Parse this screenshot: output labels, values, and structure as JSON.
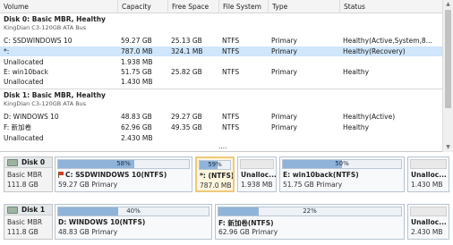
{
  "columns": [
    "Volume",
    "Capacity",
    "Free Space",
    "File System",
    "Type",
    "Status"
  ],
  "disk0": {
    "title": "Disk 0: Basic MBR, Healthy",
    "subtitle": "KingDian C3-120GB ATA Bus",
    "rows": [
      {
        "volume": "C: SSDWINDOWS 10",
        "capacity": "59.27 GB",
        "free": "25.13 GB",
        "fs": "NTFS",
        "type": "Primary",
        "status": "Healthy(Active,System,8..."
      },
      {
        "volume": "*:",
        "capacity": "787.0 MB",
        "free": "324.1 MB",
        "fs": "NTFS",
        "type": "Primary",
        "status": "Healthy(Recovery)"
      },
      {
        "volume": "Unallocated",
        "capacity": "1.938 MB",
        "free": "",
        "fs": "",
        "type": "",
        "status": ""
      },
      {
        "volume": "E: win10back",
        "capacity": "51.75 GB",
        "free": "25.82 GB",
        "fs": "NTFS",
        "type": "Primary",
        "status": "Healthy"
      },
      {
        "volume": "Unallocated",
        "capacity": "1.430 MB",
        "free": "",
        "fs": "",
        "type": "",
        "status": ""
      }
    ]
  },
  "disk1": {
    "title": "Disk 1: Basic MBR, Healthy",
    "subtitle": "KingDian C3-120GB ATA Bus",
    "rows": [
      {
        "volume": "D: WINDOWS 10",
        "capacity": "48.83 GB",
        "free": "29.27 GB",
        "fs": "NTFS",
        "type": "Primary",
        "status": "Healthy(Active)"
      },
      {
        "volume": "F: 新加卷",
        "capacity": "62.96 GB",
        "free": "49.35 GB",
        "fs": "NTFS",
        "type": "Primary",
        "status": "Healthy"
      },
      {
        "volume": "Unallocated",
        "capacity": "2.430 MB",
        "free": "",
        "fs": "",
        "type": "",
        "status": ""
      }
    ]
  },
  "more_indicator": "....",
  "map": {
    "disk0": {
      "name": "Disk 0",
      "style": "Basic MBR",
      "size": "111.8 GB",
      "parts": [
        {
          "pct": "58%",
          "used": 0.58,
          "name": "C: SSDWINDOWS 10(NTFS)",
          "info": "59.27 GB Primary"
        },
        {
          "pct": "59%",
          "used": 0.59,
          "name": "*: (NTFS)",
          "info": "787.0 MB"
        },
        {
          "name": "Unalloc...",
          "info": "1.938 MB"
        },
        {
          "pct": "50%",
          "used": 0.5,
          "name": "E: win10back(NTFS)",
          "info": "51.75 GB Primary"
        },
        {
          "name": "Unalloc...",
          "info": "1.430 MB"
        }
      ]
    },
    "disk1": {
      "name": "Disk 1",
      "style": "Basic MBR",
      "size": "111.8 GB",
      "parts": [
        {
          "pct": "40%",
          "used": 0.4,
          "name": "D: WINDOWS 10(NTFS)",
          "info": "48.83 GB Primary"
        },
        {
          "pct": "22%",
          "used": 0.22,
          "name": "F: 新加卷(NTFS)",
          "info": "62.96 GB Primary"
        },
        {
          "name": "Unalloc...",
          "info": "2.430 MB"
        }
      ]
    }
  },
  "colors": {
    "selected_row": "#cfe6fb",
    "bar_fill": "#8fb3d9",
    "selected_part": "#efc97a"
  }
}
